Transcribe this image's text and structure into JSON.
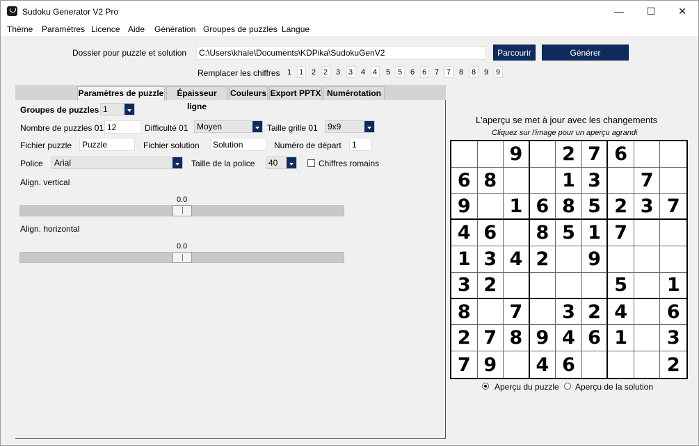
{
  "window": {
    "title": "Sudoku Generator V2 Pro",
    "minimize": "—",
    "maximize": "☐",
    "close": "✕"
  },
  "menu": [
    "Thème",
    "Paramètres",
    "Licence",
    "Aide",
    "Génération",
    "Groupes de puzzles",
    "Langue"
  ],
  "folder": {
    "label": "Dossier pour puzzle et solution",
    "path": "C:\\Users\\khale\\Documents\\KDPika\\SudokuGenV2",
    "browse": "Parcourir",
    "generate": "Générer"
  },
  "replace": {
    "label": "Remplacer les chiffres",
    "digits": [
      "1",
      "2",
      "3",
      "4",
      "5",
      "6",
      "7",
      "8",
      "9"
    ],
    "values": [
      "1",
      "2",
      "3",
      "4",
      "5",
      "6",
      "7",
      "8",
      "9"
    ]
  },
  "tabs": [
    "Paramètres de puzzle",
    "Épaisseur ligne",
    "Couleurs",
    "Export PPTX",
    "Numérotation"
  ],
  "active_tab": "Paramètres de puzzle",
  "params": {
    "group_label": "Groupes de puzzles",
    "group_value": "1",
    "count_label": "Nombre de puzzles 01",
    "count_value": "12",
    "difficulty_label": "Difficulté 01",
    "difficulty_value": "Moyen",
    "size_label": "Taille grille 01",
    "size_value": "9x9",
    "puzzle_file_label": "Fichier puzzle",
    "puzzle_file_value": "Puzzle",
    "solution_file_label": "Fichier solution",
    "solution_file_value": "Solution",
    "start_label": "Numéro de départ",
    "start_value": "1",
    "font_label": "Police",
    "font_value": "Arial",
    "font_size_label": "Taille de la police",
    "font_size_value": "40",
    "roman_label": "Chiffres romains",
    "roman_checked": false,
    "valign_label": "Align. vertical",
    "valign_value": "0.0",
    "halign_label": "Align. horizontal",
    "halign_value": "0.0",
    "valign_level": 0.5,
    "halign_level": 0.5
  },
  "preview": {
    "title": "L'aperçu se met à jour avec les changements",
    "subtitle": "Cliquez sur l'image pour un aperçu agrandi",
    "grid": [
      [
        "",
        "",
        "9",
        "",
        "2",
        "7",
        "6",
        "",
        ""
      ],
      [
        "6",
        "8",
        "",
        "",
        "1",
        "3",
        "",
        "7",
        ""
      ],
      [
        "9",
        "",
        "1",
        "6",
        "8",
        "5",
        "2",
        "3",
        "7"
      ],
      [
        "4",
        "6",
        "",
        "8",
        "5",
        "1",
        "7",
        "",
        ""
      ],
      [
        "1",
        "3",
        "4",
        "2",
        "",
        "9",
        "",
        "",
        ""
      ],
      [
        "3",
        "2",
        "",
        "",
        "",
        "",
        "5",
        "",
        "1"
      ],
      [
        "8",
        "",
        "7",
        "",
        "3",
        "2",
        "4",
        "",
        "6"
      ],
      [
        "2",
        "7",
        "8",
        "9",
        "4",
        "6",
        "1",
        "",
        "3"
      ],
      [
        "7",
        "9",
        "",
        "4",
        "6",
        "",
        "",
        "",
        "2"
      ]
    ],
    "radio_puzzle": "Aperçu du puzzle",
    "radio_solution": "Aperçu de la solution",
    "selected": "puzzle"
  }
}
